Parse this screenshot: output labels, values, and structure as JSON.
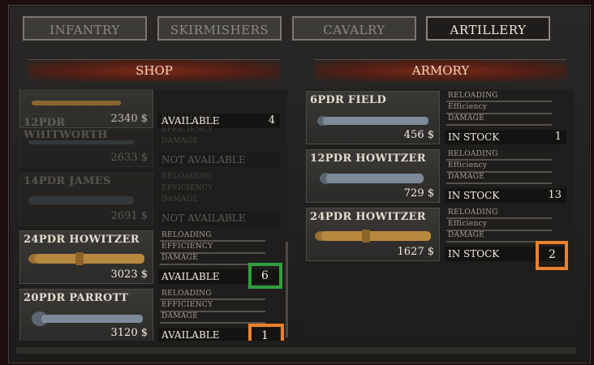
{
  "tabs": [
    {
      "label": "INFANTRY",
      "active": false
    },
    {
      "label": "SKIRMISHERS",
      "active": false
    },
    {
      "label": "CAVALRY",
      "active": false
    },
    {
      "label": "ARTILLERY",
      "active": true
    }
  ],
  "shop": {
    "header": "SHOP",
    "items": [
      {
        "name": "",
        "price": "2340 $",
        "stats": [
          "",
          "",
          ""
        ],
        "status": "AVAILABLE",
        "count": "4",
        "enabled": true
      },
      {
        "name": "12PDR WHITWORTH",
        "price": "2633 $",
        "stats": [
          "RELOADING",
          "EFFICIENCY",
          "DAMAGE"
        ],
        "status": "NOT AVAILABLE",
        "count": "",
        "enabled": false
      },
      {
        "name": "14PDR JAMES",
        "price": "2691 $",
        "stats": [
          "RELOADING",
          "EFFICIENCY",
          "DAMAGE"
        ],
        "status": "NOT AVAILABLE",
        "count": "",
        "enabled": false
      },
      {
        "name": "24PDR HOWITZER",
        "price": "3023 $",
        "stats": [
          "RELOADING",
          "EFFICIENCY",
          "DAMAGE"
        ],
        "status": "AVAILABLE",
        "count": "6",
        "enabled": true
      },
      {
        "name": "20PDR PARROTT",
        "price": "3120 $",
        "stats": [
          "RELOADING",
          "EFFICIENCY",
          "DAMAGE"
        ],
        "status": "AVAILABLE",
        "count": "1",
        "enabled": true
      }
    ]
  },
  "armory": {
    "header": "ARMORY",
    "items": [
      {
        "name": "6PDR FIELD",
        "price": "456 $",
        "stats": [
          "RELOADING",
          "Efficiency",
          "DAMAGE"
        ],
        "status": "IN STOCK",
        "count": "1"
      },
      {
        "name": "12PDR HOWITZER",
        "price": "729 $",
        "stats": [
          "RELOADING",
          "Efficiency",
          "DAMAGE"
        ],
        "status": "IN STOCK",
        "count": "13"
      },
      {
        "name": "24PDR HOWITZER",
        "price": "1627 $",
        "stats": [
          "RELOADING",
          "Efficiency",
          "DAMAGE"
        ],
        "status": "IN STOCK",
        "count": "2"
      }
    ]
  },
  "colors": {
    "highlight_green": "#2f9e3d",
    "highlight_orange": "#e8822e",
    "bronze": "#b7893f",
    "steel": "#7d8a98"
  }
}
